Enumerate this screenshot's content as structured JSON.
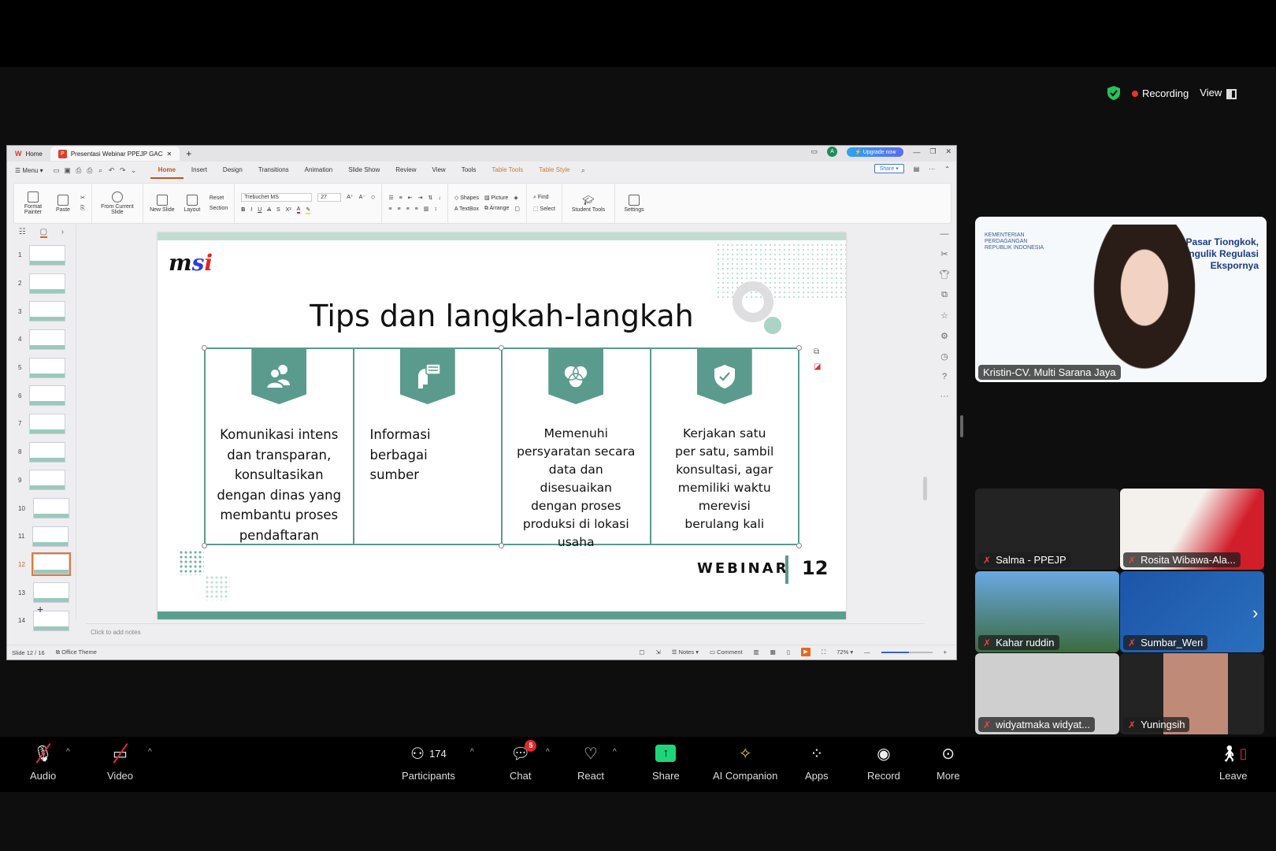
{
  "zoom_top": {
    "recording_label": "Recording",
    "view_label": "View"
  },
  "wps": {
    "tabs": [
      {
        "label": "Home",
        "icon": "wps-icon"
      },
      {
        "label": "Presentasi Webinar PPEJP GAC",
        "icon": "ppt-icon"
      }
    ],
    "upgrade_label": "Upgrade now",
    "account_initial": "A",
    "menu_label": "Menu",
    "ribbon_tabs": [
      "Home",
      "Insert",
      "Design",
      "Transitions",
      "Animation",
      "Slide Show",
      "Review",
      "View",
      "Tools"
    ],
    "context_tabs": [
      "Table Tools",
      "Table Style"
    ],
    "share_label": "Share",
    "ribbon": {
      "format_painter": "Format Painter",
      "paste": "Paste",
      "from_current": "From Current Slide",
      "new_slide": "New Slide",
      "layout": "Layout",
      "reset": "Reset",
      "section": "Section",
      "font_name": "Trebuchet MS",
      "font_size": "27",
      "shapes": "Shapes",
      "picture": "Picture",
      "textbox": "TextBox",
      "arrange": "Arrange",
      "find": "Find",
      "select": "Select",
      "student_tools": "Student Tools",
      "settings": "Settings"
    },
    "thumbnails": [
      "1",
      "2",
      "3",
      "4",
      "5",
      "6",
      "7",
      "8",
      "9",
      "10",
      "11",
      "12",
      "13",
      "14"
    ],
    "current_slide": "12",
    "notes_placeholder": "Click to add notes",
    "status": {
      "slide_info": "Slide 12 / 16",
      "theme": "Office Theme",
      "notes": "Notes",
      "comment": "Comment",
      "zoom": "72%"
    }
  },
  "slide": {
    "title": "Tips dan langkah-langkah",
    "logo": {
      "m": "m",
      "s": "s",
      "i": "i"
    },
    "columns": [
      {
        "icon": "people-icon",
        "text": "Komunikasi intens\ndan transparan,\nkonsultasikan\ndengan dinas yang\nmembantu proses\npendaftaran"
      },
      {
        "icon": "head-chat-icon",
        "text": "Informasi\n            berbagai\n            sumber"
      },
      {
        "icon": "venn-icon",
        "text": "Memenuhi\npersyaratan secara\ndata dan disesuaikan\ndengan proses\nproduksi di lokasi\nusaha"
      },
      {
        "icon": "shield-check-icon",
        "text": "Kerjakan satu\nper  satu, sambil\nkonsultasi, agar\nmemiliki waktu\nmerevisi\nberulang  kali"
      }
    ],
    "footer_label": "WEBINAR",
    "page_number": "12"
  },
  "speaker": {
    "name": "Kristin-CV. Multi Sarana Jaya",
    "org": "KEMENTERIAN\nPERDAGANGAN\nREPUBLIK INDONESIA",
    "banner": "lik Pasar Tiongkok,\nMengulik Regulasi\nEkspornya"
  },
  "participants_tiles": [
    {
      "name": "Salma - PPEJP",
      "muted": true
    },
    {
      "name": "Rosita Wibawa-Ala...",
      "muted": true
    },
    {
      "name": "Kahar ruddin",
      "muted": true
    },
    {
      "name": "Sumbar_Weri",
      "muted": true
    },
    {
      "name": "widyatmaka widyat...",
      "muted": true
    },
    {
      "name": "Yuningsih",
      "muted": true
    }
  ],
  "toolbar": {
    "audio": "Audio",
    "video": "Video",
    "participants": "Participants",
    "participants_count": "174",
    "chat": "Chat",
    "chat_badge": "5",
    "react": "React",
    "share": "Share",
    "ai_companion": "AI Companion",
    "apps": "Apps",
    "record": "Record",
    "more": "More",
    "leave": "Leave"
  },
  "colors": {
    "accent_teal": "#5a9b8d",
    "share_green": "#1ed67a",
    "leave_red": "#e0284f",
    "recording_red": "#e8312f"
  }
}
